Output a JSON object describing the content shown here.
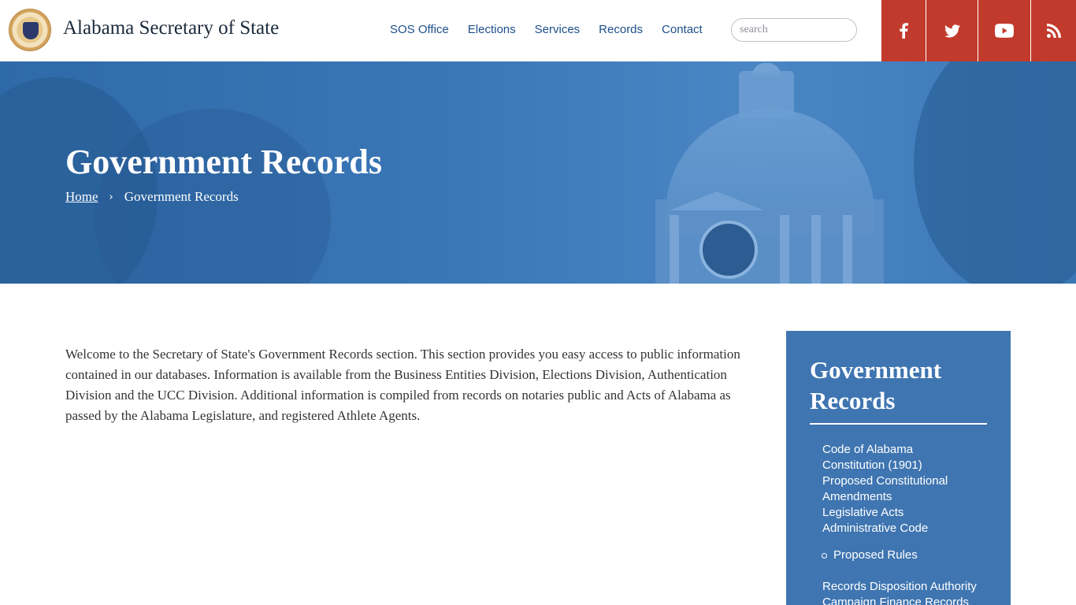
{
  "header": {
    "site_title": "Alabama Secretary of State",
    "nav": [
      "SOS Office",
      "Elections",
      "Services",
      "Records",
      "Contact"
    ],
    "search_placeholder": "search",
    "social": [
      "facebook-icon",
      "twitter-icon",
      "youtube-icon",
      "rss-icon"
    ]
  },
  "hero": {
    "title": "Government Records",
    "breadcrumb": {
      "home": "Home",
      "separator": "›",
      "current": "Government Records"
    }
  },
  "main": {
    "intro": "Welcome to the Secretary of State's Government Records section. This section provides you easy access to public information contained in our databases. Information is available from the Business Entities Division, Elections Division, Authentication Division and the UCC Division. Additional information is compiled from records on notaries public and Acts of Alabama as passed by the Alabama Legislature, and registered Athlete Agents."
  },
  "sidebar": {
    "title": "Government Records",
    "links": [
      "Code of Alabama",
      "Constitution (1901)",
      "Proposed Constitutional Amendments",
      "Legislative Acts",
      "Administrative Code"
    ],
    "sublinks": [
      "Proposed Rules"
    ],
    "links_after": [
      "Records Disposition Authority",
      "Campaign Finance Records"
    ]
  },
  "colors": {
    "nav_link": "#1d4f8a",
    "social_bg": "#c23a2c",
    "hero_blue": "#3a76b6",
    "sidebar_bg": "#3f75b1"
  }
}
